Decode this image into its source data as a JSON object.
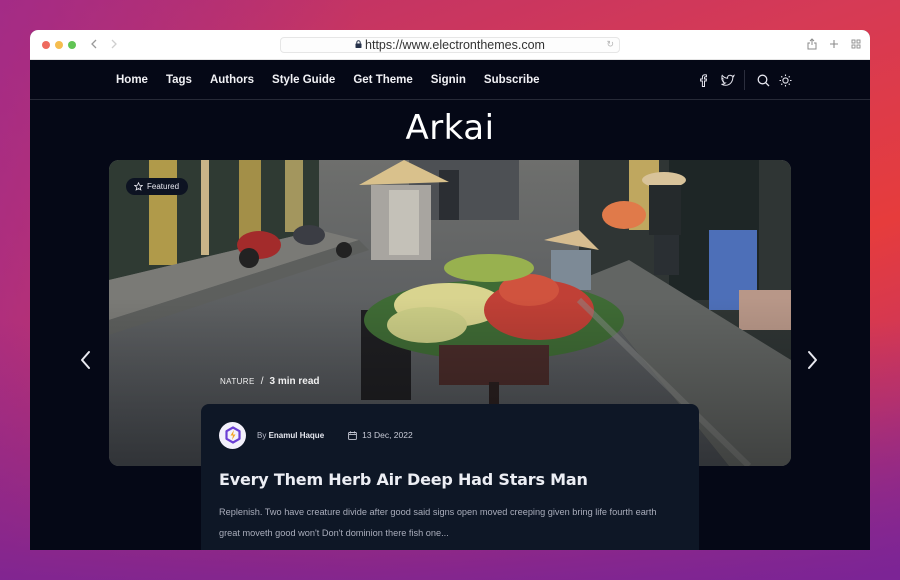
{
  "browser": {
    "url": "https://www.electronthemes.com",
    "back_icon": "chevron-left-icon",
    "forward_icon": "chevron-right-icon",
    "actions": [
      "share-icon",
      "new-tab-icon",
      "tab-overview-icon"
    ]
  },
  "header": {
    "menu": [
      {
        "label": "Home"
      },
      {
        "label": "Tags"
      },
      {
        "label": "Authors"
      },
      {
        "label": "Style Guide"
      },
      {
        "label": "Get Theme"
      },
      {
        "label": "Signin"
      },
      {
        "label": "Subscribe"
      }
    ],
    "icons": [
      "facebook-icon",
      "twitter-icon",
      "search-icon",
      "theme-toggle-icon"
    ]
  },
  "site": {
    "title": "Arkai"
  },
  "hero": {
    "badge": "Featured",
    "tag": "Nature",
    "separator": "/",
    "read_time": "3 min read",
    "image_description": "Street vendor carrying bicycle with fruit on a narrow street"
  },
  "post": {
    "author_prefix": "By",
    "author": "Enamul Haque",
    "date": "13 Dec, 2022",
    "title": "Every Them Herb Air Deep Had Stars Man",
    "excerpt": "Replenish. Two have creature divide after good said signs open moved creeping given bring life fourth earth great moveth good won't Don't dominion there fish one..."
  },
  "colors": {
    "page_bg": "#050816",
    "card_bg": "#0e1726",
    "badge_bg": "#0d1322",
    "avatar_accent": "#6b3fd4",
    "avatar_bolt": "#f5a623"
  }
}
